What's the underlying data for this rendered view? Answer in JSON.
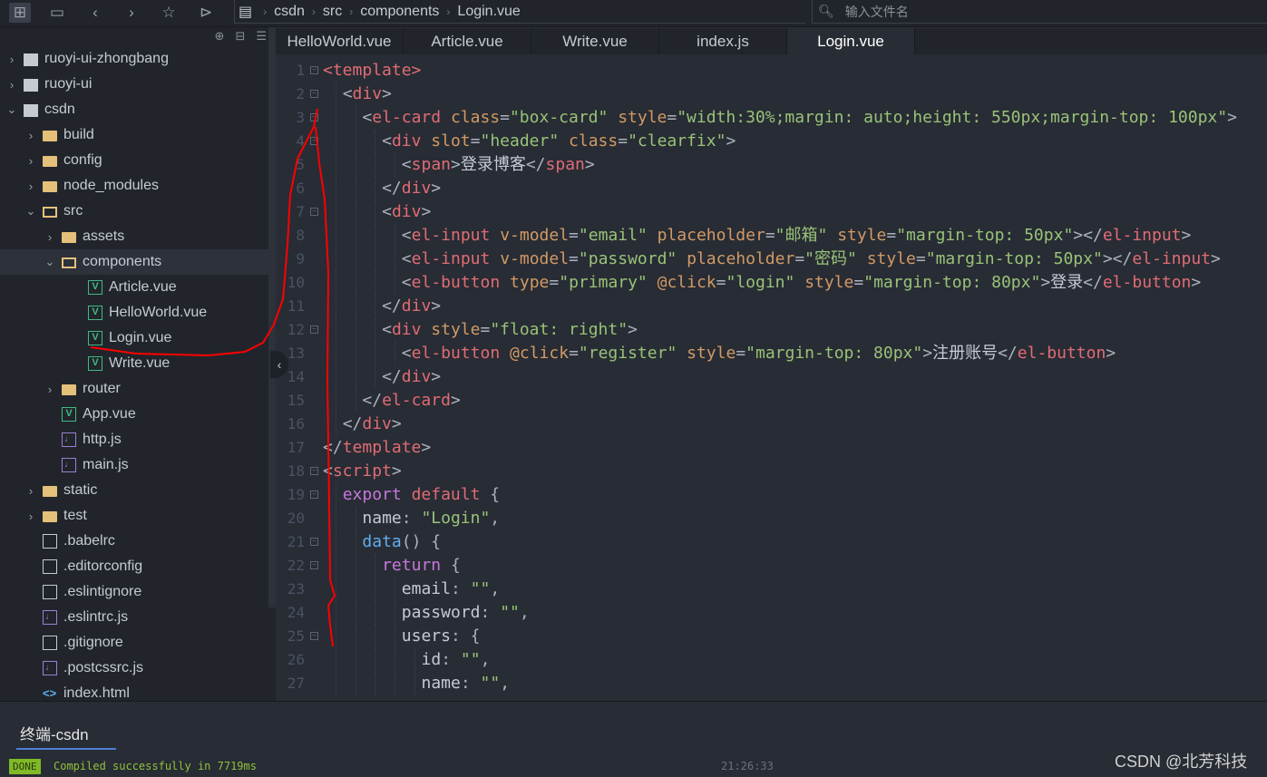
{
  "toolbar": {
    "icons": [
      "new-file-icon",
      "save-icon",
      "back-icon",
      "forward-icon",
      "star-icon",
      "run-icon"
    ]
  },
  "breadcrumb": [
    "csdn",
    "src",
    "components",
    "Login.vue"
  ],
  "search": {
    "placeholder": "输入文件名"
  },
  "sidebar": {
    "tree": [
      {
        "label": "ruoyi-ui-zhongbang",
        "depth": 0,
        "chev": "closed",
        "icon": "project"
      },
      {
        "label": "ruoyi-ui",
        "depth": 0,
        "chev": "closed",
        "icon": "project"
      },
      {
        "label": "csdn",
        "depth": 0,
        "chev": "open",
        "icon": "project"
      },
      {
        "label": "build",
        "depth": 1,
        "chev": "closed",
        "icon": "folder"
      },
      {
        "label": "config",
        "depth": 1,
        "chev": "closed",
        "icon": "folder"
      },
      {
        "label": "node_modules",
        "depth": 1,
        "chev": "closed",
        "icon": "folder"
      },
      {
        "label": "src",
        "depth": 1,
        "chev": "open",
        "icon": "folder-open"
      },
      {
        "label": "assets",
        "depth": 2,
        "chev": "closed",
        "icon": "folder"
      },
      {
        "label": "components",
        "depth": 2,
        "chev": "open",
        "icon": "folder-open",
        "selected": true
      },
      {
        "label": "Article.vue",
        "depth": 3,
        "icon": "vue"
      },
      {
        "label": "HelloWorld.vue",
        "depth": 3,
        "icon": "vue"
      },
      {
        "label": "Login.vue",
        "depth": 3,
        "icon": "vue"
      },
      {
        "label": "Write.vue",
        "depth": 3,
        "icon": "vue"
      },
      {
        "label": "router",
        "depth": 2,
        "chev": "closed",
        "icon": "folder"
      },
      {
        "label": "App.vue",
        "depth": 2,
        "icon": "vue"
      },
      {
        "label": "http.js",
        "depth": 2,
        "icon": "js"
      },
      {
        "label": "main.js",
        "depth": 2,
        "icon": "js"
      },
      {
        "label": "static",
        "depth": 1,
        "chev": "closed",
        "icon": "folder"
      },
      {
        "label": "test",
        "depth": 1,
        "chev": "closed",
        "icon": "folder"
      },
      {
        "label": ".babelrc",
        "depth": 1,
        "icon": "file"
      },
      {
        "label": ".editorconfig",
        "depth": 1,
        "icon": "file"
      },
      {
        "label": ".eslintignore",
        "depth": 1,
        "icon": "file"
      },
      {
        "label": ".eslintrc.js",
        "depth": 1,
        "icon": "js"
      },
      {
        "label": ".gitignore",
        "depth": 1,
        "icon": "file"
      },
      {
        "label": ".postcssrc.js",
        "depth": 1,
        "icon": "js"
      },
      {
        "label": "index.html",
        "depth": 1,
        "icon": "html"
      }
    ]
  },
  "tabs": [
    {
      "label": "HelloWorld.vue"
    },
    {
      "label": "Article.vue"
    },
    {
      "label": "Write.vue"
    },
    {
      "label": "index.js"
    },
    {
      "label": "Login.vue",
      "active": true
    }
  ],
  "editor": {
    "lines": [
      {
        "n": 1,
        "fold": true,
        "i": 0,
        "tk": [
          [
            "t",
            "<template>"
          ]
        ]
      },
      {
        "n": 2,
        "fold": true,
        "i": 1,
        "tk": [
          [
            "p",
            "<"
          ],
          [
            "t",
            "div"
          ],
          [
            "p",
            ">"
          ]
        ]
      },
      {
        "n": 3,
        "fold": true,
        "i": 2,
        "tk": [
          [
            "p",
            "<"
          ],
          [
            "t",
            "el-card"
          ],
          [
            "x",
            " "
          ],
          [
            "a",
            "class"
          ],
          [
            "p",
            "="
          ],
          [
            "s",
            "\"box-card\""
          ],
          [
            "x",
            " "
          ],
          [
            "a",
            "style"
          ],
          [
            "p",
            "="
          ],
          [
            "s",
            "\"width:30%;margin: auto;height: 550px;margin-top: 100px\""
          ],
          [
            "p",
            ">"
          ]
        ]
      },
      {
        "n": 4,
        "fold": true,
        "i": 3,
        "tk": [
          [
            "p",
            "<"
          ],
          [
            "t",
            "div"
          ],
          [
            "x",
            " "
          ],
          [
            "a",
            "slot"
          ],
          [
            "p",
            "="
          ],
          [
            "s",
            "\"header\""
          ],
          [
            "x",
            " "
          ],
          [
            "a",
            "class"
          ],
          [
            "p",
            "="
          ],
          [
            "s",
            "\"clearfix\""
          ],
          [
            "p",
            ">"
          ]
        ]
      },
      {
        "n": 5,
        "i": 4,
        "tk": [
          [
            "p",
            "<"
          ],
          [
            "t",
            "span"
          ],
          [
            "p",
            ">"
          ],
          [
            "x",
            "登录博客"
          ],
          [
            "p",
            "</"
          ],
          [
            "t",
            "span"
          ],
          [
            "p",
            ">"
          ]
        ]
      },
      {
        "n": 6,
        "i": 3,
        "tk": [
          [
            "p",
            "</"
          ],
          [
            "t",
            "div"
          ],
          [
            "p",
            ">"
          ]
        ]
      },
      {
        "n": 7,
        "fold": true,
        "i": 3,
        "tk": [
          [
            "p",
            "<"
          ],
          [
            "t",
            "div"
          ],
          [
            "p",
            ">"
          ]
        ]
      },
      {
        "n": 8,
        "i": 4,
        "tk": [
          [
            "p",
            "<"
          ],
          [
            "t",
            "el-input"
          ],
          [
            "x",
            " "
          ],
          [
            "a",
            "v-model"
          ],
          [
            "p",
            "="
          ],
          [
            "s",
            "\"email\""
          ],
          [
            "x",
            " "
          ],
          [
            "a",
            "placeholder"
          ],
          [
            "p",
            "="
          ],
          [
            "s",
            "\"邮箱\""
          ],
          [
            "x",
            " "
          ],
          [
            "a",
            "style"
          ],
          [
            "p",
            "="
          ],
          [
            "s",
            "\"margin-top: 50px\""
          ],
          [
            "p",
            "></"
          ],
          [
            "t",
            "el-input"
          ],
          [
            "p",
            ">"
          ]
        ]
      },
      {
        "n": 9,
        "i": 4,
        "tk": [
          [
            "p",
            "<"
          ],
          [
            "t",
            "el-input"
          ],
          [
            "x",
            " "
          ],
          [
            "a",
            "v-model"
          ],
          [
            "p",
            "="
          ],
          [
            "s",
            "\"password\""
          ],
          [
            "x",
            " "
          ],
          [
            "a",
            "placeholder"
          ],
          [
            "p",
            "="
          ],
          [
            "s",
            "\"密码\""
          ],
          [
            "x",
            " "
          ],
          [
            "a",
            "style"
          ],
          [
            "p",
            "="
          ],
          [
            "s",
            "\"margin-top: 50px\""
          ],
          [
            "p",
            "></"
          ],
          [
            "t",
            "el-input"
          ],
          [
            "p",
            ">"
          ]
        ]
      },
      {
        "n": 10,
        "i": 4,
        "tk": [
          [
            "p",
            "<"
          ],
          [
            "t",
            "el-button"
          ],
          [
            "x",
            " "
          ],
          [
            "a",
            "type"
          ],
          [
            "p",
            "="
          ],
          [
            "s",
            "\"primary\""
          ],
          [
            "x",
            " "
          ],
          [
            "a",
            "@click"
          ],
          [
            "p",
            "="
          ],
          [
            "s",
            "\"login\""
          ],
          [
            "x",
            " "
          ],
          [
            "a",
            "style"
          ],
          [
            "p",
            "="
          ],
          [
            "s",
            "\"margin-top: 80px\""
          ],
          [
            "p",
            ">"
          ],
          [
            "x",
            "登录"
          ],
          [
            "p",
            "</"
          ],
          [
            "t",
            "el-button"
          ],
          [
            "p",
            ">"
          ]
        ]
      },
      {
        "n": 11,
        "i": 3,
        "tk": [
          [
            "p",
            "</"
          ],
          [
            "t",
            "div"
          ],
          [
            "p",
            ">"
          ]
        ]
      },
      {
        "n": 12,
        "fold": true,
        "i": 3,
        "tk": [
          [
            "p",
            "<"
          ],
          [
            "t",
            "div"
          ],
          [
            "x",
            " "
          ],
          [
            "a",
            "style"
          ],
          [
            "p",
            "="
          ],
          [
            "s",
            "\"float: right\""
          ],
          [
            "p",
            ">"
          ]
        ]
      },
      {
        "n": 13,
        "i": 4,
        "tk": [
          [
            "p",
            "<"
          ],
          [
            "t",
            "el-button"
          ],
          [
            "x",
            " "
          ],
          [
            "a",
            "@click"
          ],
          [
            "p",
            "="
          ],
          [
            "s",
            "\"register\""
          ],
          [
            "x",
            " "
          ],
          [
            "a",
            "style"
          ],
          [
            "p",
            "="
          ],
          [
            "s",
            "\"margin-top: 80px\""
          ],
          [
            "p",
            ">"
          ],
          [
            "x",
            "注册账号"
          ],
          [
            "p",
            "</"
          ],
          [
            "t",
            "el-button"
          ],
          [
            "p",
            ">"
          ]
        ]
      },
      {
        "n": 14,
        "i": 3,
        "tk": [
          [
            "p",
            "</"
          ],
          [
            "t",
            "div"
          ],
          [
            "p",
            ">"
          ]
        ]
      },
      {
        "n": 15,
        "i": 2,
        "tk": [
          [
            "p",
            "</"
          ],
          [
            "t",
            "el-card"
          ],
          [
            "p",
            ">"
          ]
        ]
      },
      {
        "n": 16,
        "i": 1,
        "tk": [
          [
            "p",
            "</"
          ],
          [
            "t",
            "div"
          ],
          [
            "p",
            ">"
          ]
        ]
      },
      {
        "n": 17,
        "i": 0,
        "tk": [
          [
            "p",
            "</"
          ],
          [
            "t",
            "template"
          ],
          [
            "p",
            ">"
          ]
        ]
      },
      {
        "n": 18,
        "fold": true,
        "i": 0,
        "tk": [
          [
            "p",
            "<"
          ],
          [
            "t",
            "script"
          ],
          [
            "p",
            ">"
          ]
        ]
      },
      {
        "n": 19,
        "fold": true,
        "i": 1,
        "tk": [
          [
            "k",
            "export"
          ],
          [
            "x",
            " "
          ],
          [
            "t",
            "default"
          ],
          [
            "x",
            " "
          ],
          [
            "p",
            "{"
          ]
        ]
      },
      {
        "n": 20,
        "i": 2,
        "tk": [
          [
            "x",
            "name"
          ],
          [
            "p",
            ": "
          ],
          [
            "s",
            "\"Login\""
          ],
          [
            "p",
            ","
          ]
        ]
      },
      {
        "n": 21,
        "fold": true,
        "i": 2,
        "tk": [
          [
            "f",
            "data"
          ],
          [
            "p",
            "() {"
          ]
        ]
      },
      {
        "n": 22,
        "fold": true,
        "i": 3,
        "tk": [
          [
            "k",
            "return"
          ],
          [
            "x",
            " "
          ],
          [
            "p",
            "{"
          ]
        ]
      },
      {
        "n": 23,
        "i": 4,
        "tk": [
          [
            "x",
            "email"
          ],
          [
            "p",
            ": "
          ],
          [
            "s",
            "\"\""
          ],
          [
            "p",
            ","
          ]
        ]
      },
      {
        "n": 24,
        "i": 4,
        "tk": [
          [
            "x",
            "password"
          ],
          [
            "p",
            ": "
          ],
          [
            "s",
            "\"\""
          ],
          [
            "p",
            ","
          ]
        ]
      },
      {
        "n": 25,
        "fold": true,
        "i": 4,
        "tk": [
          [
            "x",
            "users"
          ],
          [
            "p",
            ": {"
          ]
        ]
      },
      {
        "n": 26,
        "i": 5,
        "tk": [
          [
            "x",
            "id"
          ],
          [
            "p",
            ": "
          ],
          [
            "s",
            "\"\""
          ],
          [
            "p",
            ","
          ]
        ]
      },
      {
        "n": 27,
        "i": 5,
        "tk": [
          [
            "x",
            "name"
          ],
          [
            "p",
            ": "
          ],
          [
            "s",
            "\"\""
          ],
          [
            "p",
            ","
          ]
        ]
      }
    ]
  },
  "terminal": {
    "tab_label": "终端-csdn",
    "badge": "DONE",
    "message": "Compiled successfully in 7719ms",
    "time": "21:26:33"
  },
  "watermark": "CSDN @北芳科技",
  "colors": {
    "tag": "#e06c75",
    "attr": "#d19a66",
    "string": "#98c379",
    "keyword": "#c678dd",
    "function": "#61afef",
    "annotation": "#ff0000",
    "done_badge": "#7fb927"
  }
}
